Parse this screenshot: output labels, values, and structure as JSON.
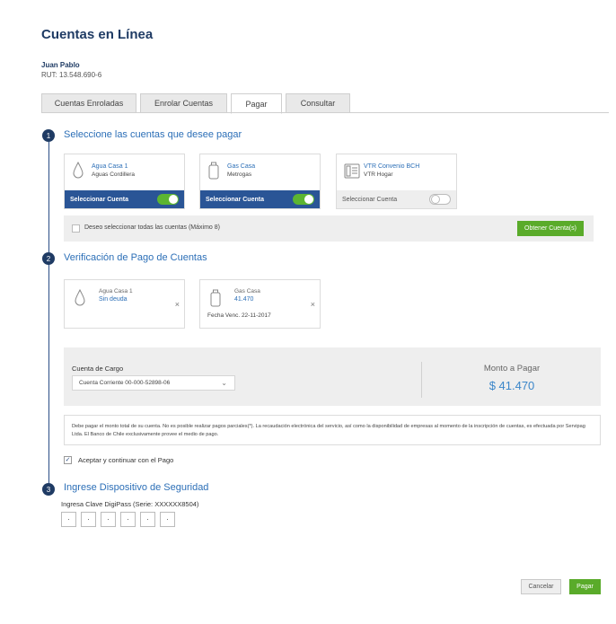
{
  "header": {
    "title": "Cuentas en Línea",
    "user_name": "Juan Pablo",
    "user_rut": "RUT: 13.548.690-6"
  },
  "tabs": [
    {
      "label": "Cuentas Enroladas",
      "active": false
    },
    {
      "label": "Enrolar Cuentas",
      "active": false
    },
    {
      "label": "Pagar",
      "active": true
    },
    {
      "label": "Consultar",
      "active": false
    }
  ],
  "steps": [
    {
      "number": "1",
      "title": "Seleccione las cuentas que desee pagar"
    },
    {
      "number": "2",
      "title": "Verificación de Pago de Cuentas"
    },
    {
      "number": "3",
      "title": "Ingrese Dispositivo de Seguridad"
    }
  ],
  "accounts": [
    {
      "name": "Agua Casa 1",
      "provider": "Aguas Cordillera",
      "icon": "water-drop-icon",
      "select_label": "Seleccionar Cuenta",
      "selected": true
    },
    {
      "name": "Gas Casa",
      "provider": "Metrogas",
      "icon": "gas-cylinder-icon",
      "select_label": "Seleccionar Cuenta",
      "selected": true
    },
    {
      "name": "VTR Convenio BCH",
      "provider": "VTR Hogar",
      "icon": "telephone-icon",
      "select_label": "Seleccionar Cuenta",
      "selected": false
    }
  ],
  "select_all": {
    "label": "Deseo seleccionar todas las cuentas (Máximo 8)",
    "button": "Obtener Cuenta(s)"
  },
  "verification": [
    {
      "name": "Agua Casa 1",
      "value": "Sin deuda",
      "due": "",
      "icon": "water-drop-icon"
    },
    {
      "name": "Gas Casa",
      "value": "41.470",
      "due": "Fecha Venc. 22-11-2017",
      "icon": "gas-cylinder-icon"
    }
  ],
  "payment": {
    "cargo_label": "Cuenta de Cargo",
    "cargo_value": "Cuenta Corriente 00-000-52898-06",
    "monto_label": "Monto a Pagar",
    "monto_value": "$ 41.470"
  },
  "disclaimer": "Debe pagar el monto total de su cuenta. No es posible realizar pagos parciales(*). La recaudación electrónica del servicio, así como la disponibilidad de empresas al momento de la inscripción de cuentas, es efectuada por Servipag Ltda. El Banco de Chile exclusivamente provee el medio de pago.",
  "accept": {
    "label": "Aceptar y continuar con el Pago",
    "checked": true
  },
  "digipass": {
    "label": "Ingresa Clave DigiPass (Serie: XXXXXX8504)",
    "digits": [
      "·",
      "·",
      "·",
      "·",
      "·",
      "·"
    ]
  },
  "actions": {
    "cancel": "Cancelar",
    "pay": "Pagar"
  },
  "colors": {
    "brand": "#1f3b64",
    "accent": "#2c6fb7",
    "green": "#5aab2a",
    "selected_bg": "#2a5596"
  }
}
